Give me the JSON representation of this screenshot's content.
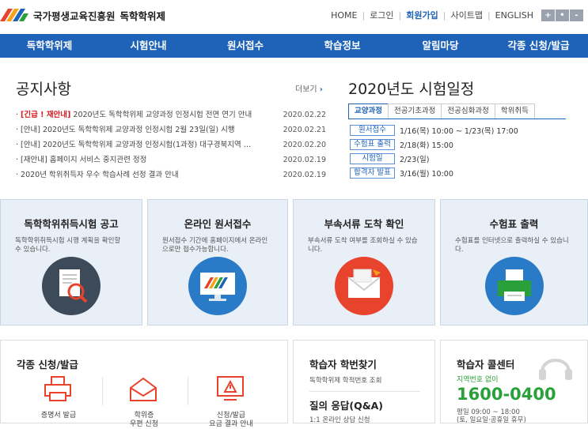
{
  "header": {
    "org_name": "국가평생교육진흥원",
    "site_name": "독학학위제",
    "util_links": [
      "HOME",
      "로그인",
      "회원가입",
      "사이트맵",
      "ENGLISH"
    ],
    "font_controls": [
      "+",
      "•",
      "-"
    ]
  },
  "gnb": [
    "독학학위제",
    "시험안내",
    "원서접수",
    "학습정보",
    "알림마당",
    "각종 신청/발급"
  ],
  "notice": {
    "title": "공지사항",
    "more_label": "더보기",
    "items": [
      {
        "tag": "[긴급 ! 재안내]",
        "text": "2020년도 독학학위제 교양과정 인정시험 전면 연기 안내",
        "date": "2020.02.22"
      },
      {
        "tag": "",
        "text": "[안내] 2020년도 독학학위제 교양과정 인정시험 2월 23일(일) 시행",
        "date": "2020.02.21"
      },
      {
        "tag": "",
        "text": "[안내] 2020년도 독학학위제 교양과정 인정시험(1과정) 대구경북지역 …",
        "date": "2020.02.20"
      },
      {
        "tag": "",
        "text": "[재안내] 홈페이지 서비스 중지관련 정정",
        "date": "2020.02.19"
      },
      {
        "tag": "",
        "text": "2020년 학위취득자 우수 학습사례 선정 결과 안내",
        "date": "2020.02.19"
      }
    ]
  },
  "schedule": {
    "title": "2020년도 시험일정",
    "tabs": [
      "교양과정",
      "전공기초과정",
      "전공심화과정",
      "학위취득"
    ],
    "rows": [
      {
        "k": "원서접수",
        "v": "1/16(목) 10:00 ~ 1/23(목) 17:00"
      },
      {
        "k": "수험표 출력",
        "v": "2/18(화) 15:00"
      },
      {
        "k": "시험일",
        "v": "2/23(일)"
      },
      {
        "k": "합격자 발표",
        "v": "3/16(월) 10:00"
      }
    ]
  },
  "cards": [
    {
      "title": "독학학위취득시험 공고",
      "desc": "독학학위취득시험 시행 계획을 확인할 수 있습니다."
    },
    {
      "title": "온라인 원서접수",
      "desc": "원서접수 기간에 홈페이지에서 온라인으로만 접수가능합니다."
    },
    {
      "title": "부속서류 도착 확인",
      "desc": "부속서류 도착 여부를 조회하실 수 있습니다."
    },
    {
      "title": "수험표 출력",
      "desc": "수험표를 인터넷으로 출력하실 수 있습니다."
    }
  ],
  "apply": {
    "title": "각종 신청/발급",
    "items": [
      "증명서 발급",
      "학위증\n우편 신청",
      "신청/발급\n요금 결과 안내"
    ]
  },
  "learner": {
    "title": "학습자 학번찾기",
    "desc": "독학학위제 학적번호 조회",
    "qa_title": "질의 응답(Q&A)",
    "qa_desc": "1:1 온라인 상담 신청"
  },
  "callcenter": {
    "title": "학습자 콜센터",
    "sub": "지역번호 없이",
    "phone": "1600-0400",
    "hours1": "평일 09:00 ~ 18:00",
    "hours2": "(토, 일요일·공휴일 휴무)"
  },
  "colors": {
    "brand": "#1f63b8",
    "urgent": "#d8191f",
    "phone": "#2aa03a"
  }
}
